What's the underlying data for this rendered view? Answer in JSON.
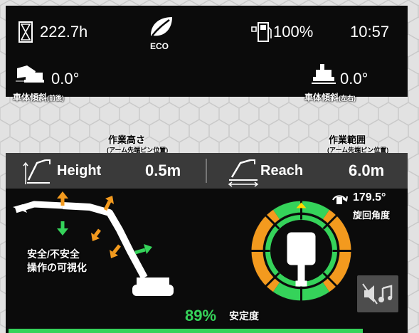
{
  "status": {
    "hour_meter": "222.7h",
    "eco_label": "ECO",
    "fuel_level": "100%",
    "clock": "10:57",
    "pitch_value": "0.0°",
    "roll_value": "0.0°"
  },
  "annotations": {
    "pitch_label_main": "車体傾斜",
    "pitch_label_sub": "(前後)",
    "roll_label_main": "車体傾斜",
    "roll_label_sub": "(左右)",
    "height_title": "作業高さ",
    "height_sub": "(アーム先端ピン位置)",
    "reach_title": "作業範囲",
    "reach_sub": "(アーム先端ピン位置)",
    "rotation_label": "旋回角度",
    "safety_viz_line1": "安全/不安全",
    "safety_viz_line2": "操作の可視化",
    "stability_label": "安定度"
  },
  "measure": {
    "height_label": "Height",
    "height_value": "0.5m",
    "reach_label": "Reach",
    "reach_value": "6.0m"
  },
  "rotation": {
    "angle": "179.5°"
  },
  "stability": {
    "percent": "89%"
  },
  "colors": {
    "safe_green": "#35d35a",
    "warn_orange": "#f39a1e",
    "indicator_yellow": "#ffd800",
    "panel": "#0b0b0b"
  }
}
